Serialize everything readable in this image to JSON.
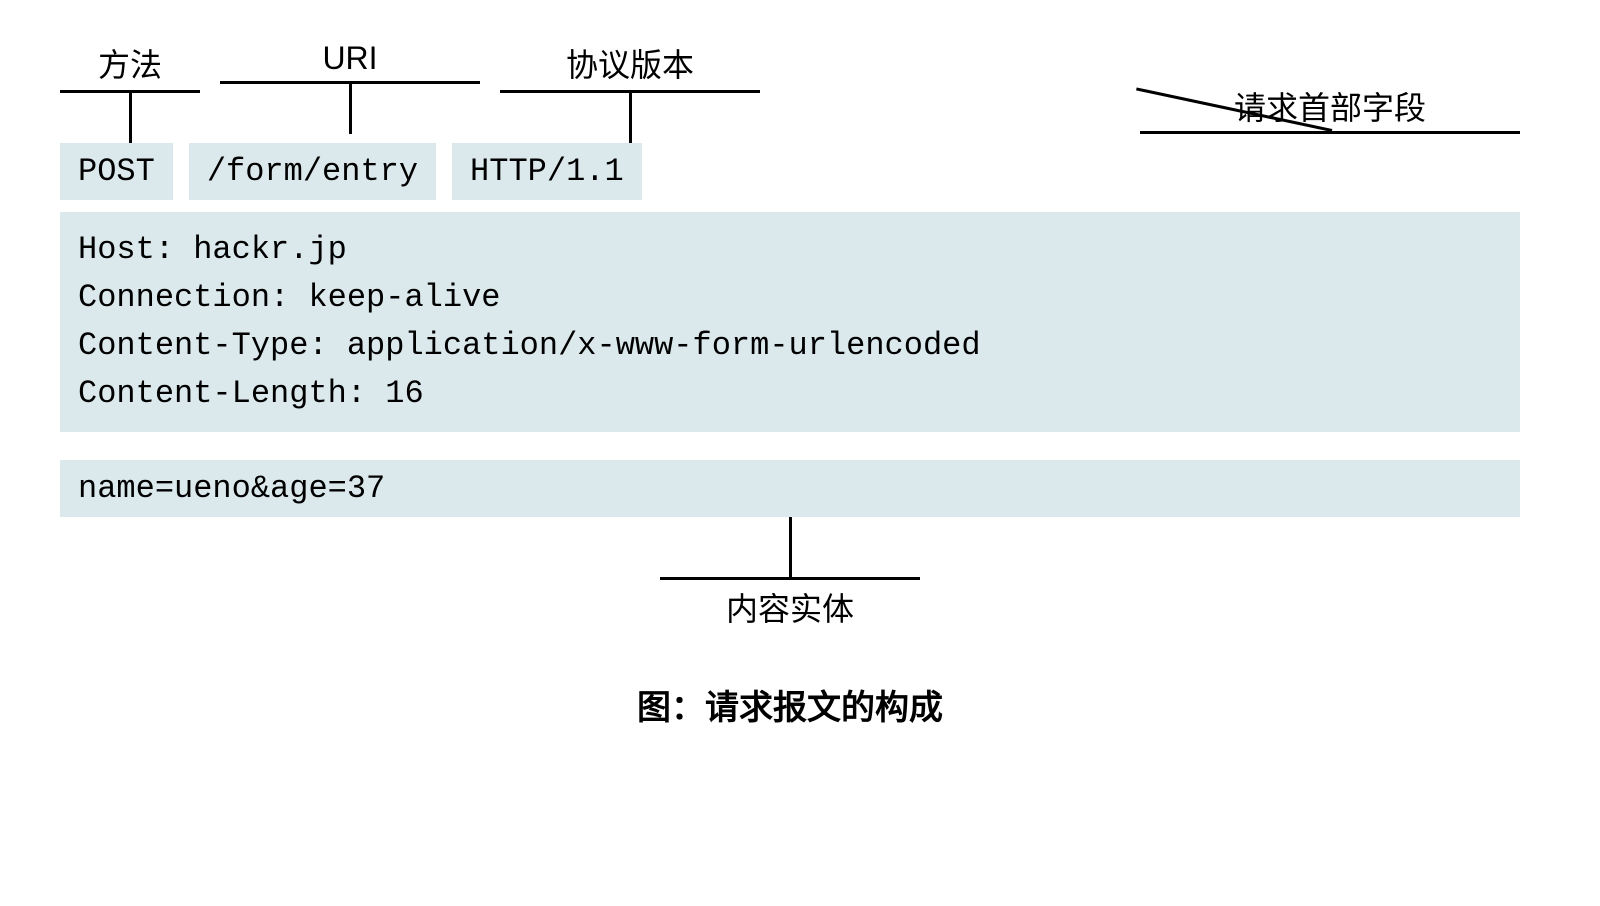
{
  "labels": {
    "method": "方法",
    "uri": "URI",
    "protocol": "协议版本",
    "headerFields": "请求首部字段",
    "entityBody": "内容实体"
  },
  "requestLine": {
    "method": "POST",
    "uri": "/form/entry",
    "protocol": "HTTP/1.1"
  },
  "headers": "Host: hackr.jp\nConnection: keep-alive\nContent-Type: application/x-www-form-urlencoded\nContent-Length: 16",
  "body": "name=ueno&age=37",
  "caption": "图：请求报文的构成"
}
